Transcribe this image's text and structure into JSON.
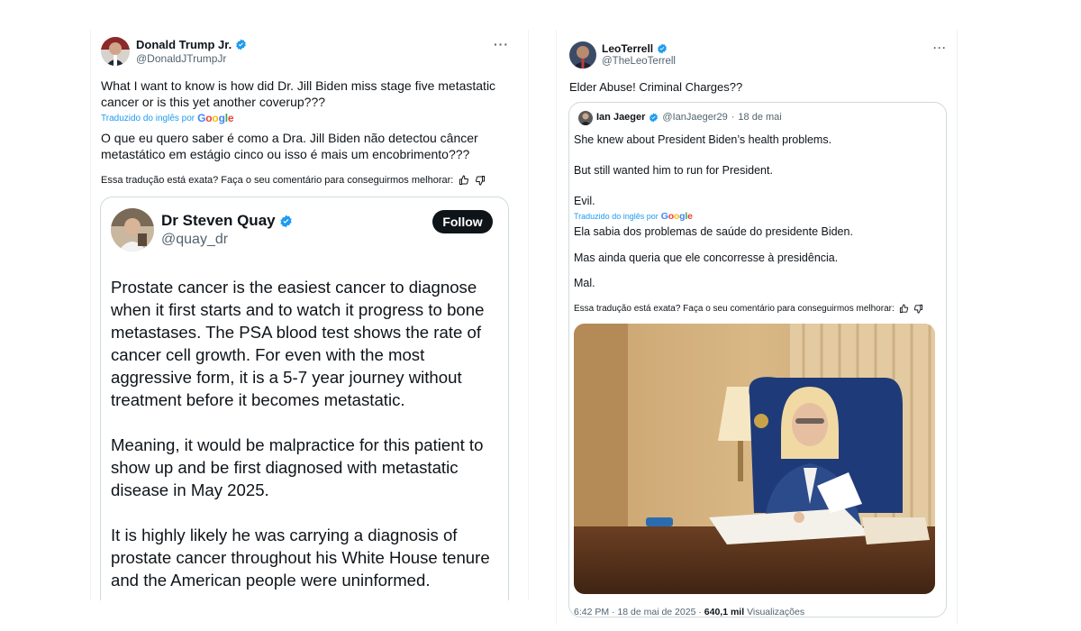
{
  "left": {
    "author_name": "Donald Trump Jr.",
    "author_handle": "@DonaldJTrumpJr",
    "more": "···",
    "text_line1": "What I want to know is how did Dr. Jill Biden miss stage five metastatic",
    "text_line2": "cancer or is this yet another coverup???",
    "translated_by": "Traduzido do inglês por",
    "google": "Google",
    "translation_line1": "O que eu quero saber é como a Dra. Jill Biden não detectou câncer",
    "translation_line2": "metastático em estágio cinco ou isso é mais um encobrimento???",
    "feedback_question": "Essa tradução está exata? Faça o seu comentário para conseguirmos melhorar:",
    "embed": {
      "name": "Dr Steven Quay",
      "handle": "@quay_dr",
      "follow_label": "Follow",
      "para1": [
        "Prostate cancer is the easiest cancer to diagnose",
        "when it first starts and to watch it progress to bone",
        "metastases. The PSA blood test shows the rate of",
        "cancer cell growth. For even with the most",
        "aggressive form, it is a 5-7 year journey without",
        "treatment before it becomes metastatic."
      ],
      "para2": [
        "Meaning, it would be malpractice for this patient to",
        "show up and be first diagnosed with metastatic",
        "disease in May 2025."
      ],
      "para3": [
        "It is highly likely he was carrying a diagnosis of",
        "prostate cancer throughout his White House tenure",
        "and the American people were uninformed."
      ]
    }
  },
  "right": {
    "author_name": "LeoTerrell",
    "author_handle": "@TheLeoTerrell",
    "more": "···",
    "text": "Elder Abuse! Criminal Charges??",
    "quote": {
      "name": "Ian Jaeger",
      "handle": "@IanJaeger29",
      "separator": "·",
      "date": "18 de mai",
      "line1": "She knew about President Biden’s health problems.",
      "line2": "But still wanted him to run for President.",
      "line3": "Evil.",
      "translated_by": "Traduzido do inglês por",
      "google": "Google",
      "tline1": "Ela sabia dos problemas de saúde do presidente Biden.",
      "tline2": "Mas ainda queria que ele concorresse à presidência.",
      "tline3": "Mal.",
      "feedback_question": "Essa tradução está exata? Faça o seu comentário para conseguirmos melhorar:"
    },
    "footer_time": "6:42 PM · 18 de mai de 2025 ·",
    "footer_views_count": "640,1 mil",
    "footer_views_label": "Visualizações"
  },
  "colors": {
    "verified": "#1d9bf0",
    "link": "#1d9bf0",
    "secondary_text": "#536471",
    "border": "#cfd9de"
  },
  "icons": [
    "verified-badge-icon",
    "thumbs-up-icon",
    "thumbs-down-icon",
    "more-options-icon"
  ]
}
